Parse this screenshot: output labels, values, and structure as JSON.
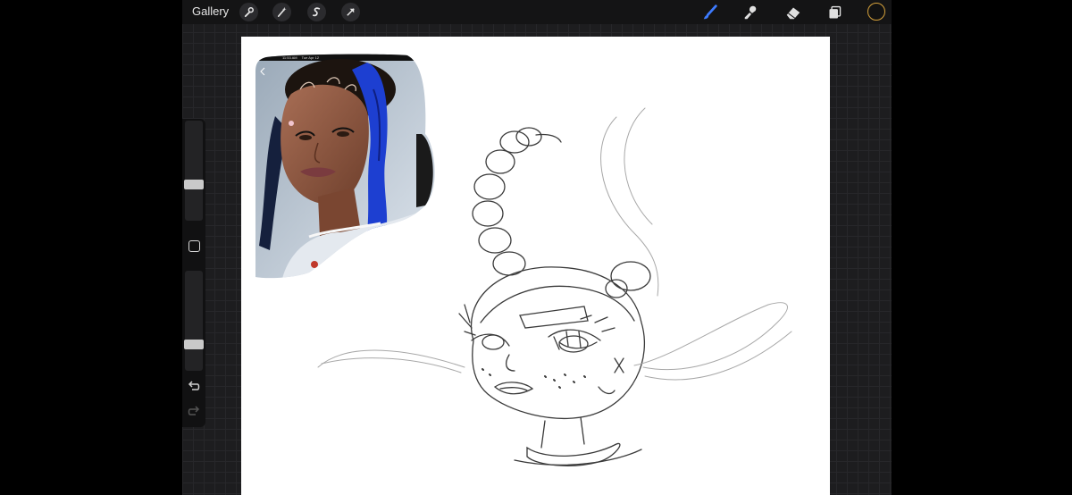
{
  "topbar": {
    "gallery_label": "Gallery",
    "tools_left": [
      "wrench-icon",
      "magic-wand-icon",
      "selection-icon",
      "transform-arrow-icon"
    ],
    "tools_right": [
      "brush-icon",
      "smudge-icon",
      "eraser-icon",
      "layers-icon"
    ],
    "active_tool": "brush-icon",
    "accent_color": "#3d7bff",
    "current_color": "#111111",
    "color_ring": "#d6a23c"
  },
  "sidebar": {
    "brush_size_level": 0.55,
    "opacity_level": 0.75
  },
  "reference": {
    "status_time": "11:53 AM",
    "status_date": "Tue Apr 12"
  }
}
